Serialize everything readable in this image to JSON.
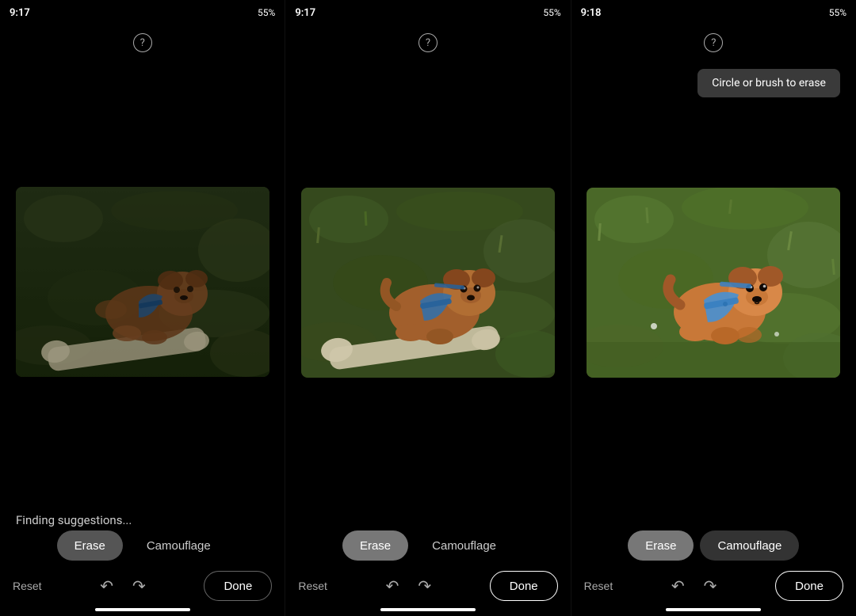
{
  "statusBars": [
    {
      "time": "9:17",
      "battery": "55%"
    },
    {
      "time": "9:17",
      "battery": "55%"
    },
    {
      "time": "9:18",
      "battery": "55%"
    }
  ],
  "tooltip": {
    "text": "Circle or brush to erase"
  },
  "panels": [
    {
      "id": "panel-1",
      "helpIcon": "?",
      "suggestionText": "Finding suggestions...",
      "eraseLabel": "Erase",
      "camouflageLabel": "Camouflage",
      "eraseActive": false,
      "camouflageActive": false,
      "resetLabel": "Reset",
      "doneLabel": "Done",
      "doneActive": false,
      "showTooltip": false,
      "imageVariant": "dark"
    },
    {
      "id": "panel-2",
      "helpIcon": "?",
      "suggestionText": "",
      "eraseLabel": "Erase",
      "camouflageLabel": "Camouflage",
      "eraseActive": true,
      "camouflageActive": false,
      "resetLabel": "Reset",
      "doneLabel": "Done",
      "doneActive": true,
      "showTooltip": false,
      "imageVariant": "medium"
    },
    {
      "id": "panel-3",
      "helpIcon": "?",
      "suggestionText": "",
      "eraseLabel": "Erase",
      "camouflageLabel": "Camouflage",
      "eraseActive": true,
      "camouflageActive": true,
      "resetLabel": "Reset",
      "doneLabel": "Done",
      "doneActive": true,
      "showTooltip": true,
      "imageVariant": "bright"
    }
  ]
}
